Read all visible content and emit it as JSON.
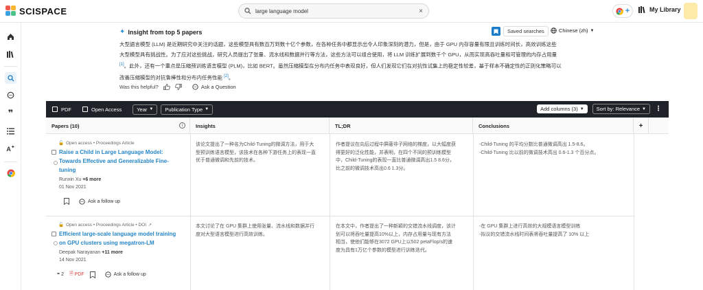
{
  "app": {
    "name": "SCISPACE"
  },
  "search": {
    "value": "large language model",
    "clear_label": "×"
  },
  "header": {
    "library_label": "My Library"
  },
  "insight": {
    "title": "Insight from top 5 papers",
    "saved_label": "Saved searches",
    "language": "Chinese (zh)",
    "lines": [
      "大型語言模型 (LLM) 是近期研究中关注的话题，这些模型具有数百万到数十亿个参数，在各种任务中都显示出令人印象深刻的潜力，但是，由于 GPU 内存容量有限且训练时间长，高效训练这些",
      "大型模型具有挑战性。为了应对这些挑战，研究人员提出了张量、流水线和数据并行等方法，这些方法可以组合使用，将 LLM 训练扩展到数千个 GPU，从而实现高吞吐量和可管理的内存占用量",
      "此外，还有一个重点是压缩预训练语言模型 (PLM)，比如 BERT。虽然压缩模型在分布内任务中表现良好，但人们发现它们在对抗性试集上的稳定性较差，基于样本不确定性的正则化策略可以",
      "改善压缩模型的对抗鲁棒性和分布内任务性能"
    ],
    "cite1": "[1]",
    "cite2": "[2]",
    "line3_prefix": "。",
    "end_mark": "。",
    "helpful_label": "Was this helpful?",
    "ask_label": "Ask a Question"
  },
  "toolbar": {
    "pdf_label": "PDF",
    "open_access_label": "Open Access",
    "year_label": "Year",
    "pubtype_label": "Publication Type",
    "add_columns_label": "Add columns (3)",
    "sort_label": "Sort by: Relevance"
  },
  "table": {
    "headers": [
      "Papers (10)",
      "Insights",
      "TL;DR",
      "Conclusions",
      "+"
    ],
    "rows": [
      {
        "meta": "Open access • Proceedings Article",
        "title_lines": [
          "Raise a Child in Large Language Model:",
          "Towards Effective and Generalizable Fine-",
          "tuning"
        ],
        "author": "Runxin Xu",
        "more": "+6 more",
        "date": "01 Nov 2021",
        "follow_label": "Ask a follow up",
        "insights": [
          "该论文提出了一种名为Child-Tuning的微调方法，用于大",
          "型预训练语言模型，该技术在各种下游任务上的表现一直",
          "优于普通微调和先前的技术。"
        ],
        "tldr": [
          "作者提议在向后过程中屏蔽非子网络的梯度，以大幅度获",
          "得更好的泛化性能，并表明，在四个不同的预训练模型",
          "中，Child-Tuning的表现一直比普通微调高出1.5 8.6分，",
          "比之前的微调技术高出0.6 1.3分。"
        ],
        "conclusions": [
          "-Child-Tuning 的平均分数比普通微调高出 1.5-8.6。",
          "-Child-Tuning 比以前的微调技术高出 0.6-1.3 个百分点。"
        ]
      },
      {
        "meta": "Open access • Proceedings Article • DOI",
        "title_lines": [
          "Efficient large-scale language model training",
          "on GPU clusters using megatron-LM"
        ],
        "author": "Deepak Narayanan",
        "more": "+11 more",
        "date": "14 Nov 2021",
        "cite_count": "2",
        "pdf_label": "PDF",
        "follow_label": "Ask a follow up",
        "insights": [
          "本文讨论了在 GPU 集群上使用张量、流水线和数据并行",
          "度对大型语言模型进行高效训练。"
        ],
        "tldr": [
          "在本文中，作者提出了一种新颖的交错流水线调度，该计",
          "划可以将吞吐量提高10%以上，内存占用量与现有方法",
          "相当，使他们能够在3072 GPU上以502 petaFlop/s的速",
          "度为具有1万亿个参数的模型进行训练迭代。"
        ],
        "conclusions": [
          "-在 GPU 集群上进行高效的大规模语言模型训练",
          "-拟议的交错流水线时间表将吞吐量提高了 10% 以上"
        ]
      }
    ]
  },
  "colors": {
    "accent": "#2585c6",
    "toolbar_bg": "#1f2329",
    "pdf_red": "#d9393a",
    "open_access": "#e2742c"
  }
}
